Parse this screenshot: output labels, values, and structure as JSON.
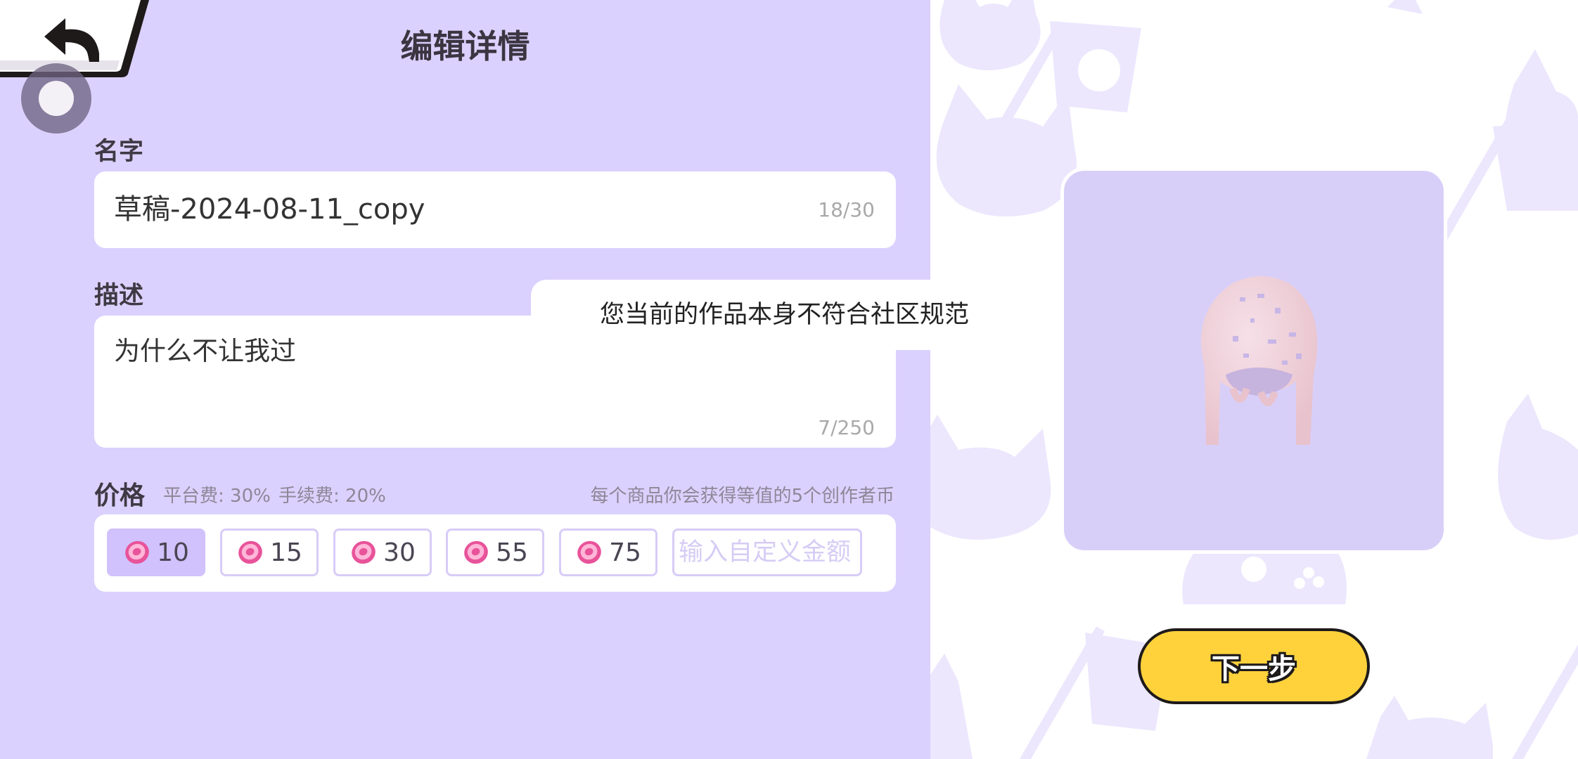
{
  "header": {
    "title": "编辑详情",
    "back_icon": "back-arrow-icon"
  },
  "name": {
    "label": "名字",
    "value": "草稿-2024-08-11_copy",
    "counter": "18/30"
  },
  "description": {
    "label": "描述",
    "value": "为什么不让我过",
    "counter": "7/250"
  },
  "price": {
    "label": "价格",
    "platform_fee": "平台费: 30%",
    "service_fee": "手续费: 20%",
    "earn_hint": "每个商品你会获得等值的5个创作者币",
    "options": [
      "10",
      "15",
      "30",
      "55",
      "75"
    ],
    "selected": "10",
    "custom_placeholder": "输入自定义金额",
    "coin_icon": "coin-icon"
  },
  "toast": {
    "message": "您当前的作品本身不符合社区规范"
  },
  "next_button": {
    "label": "下一步"
  },
  "colors": {
    "panel_bg": "#dbd1fe",
    "accent_yellow": "#ffd23c",
    "chip_selected": "#d1c1fc",
    "pattern": "#ece7fd"
  }
}
